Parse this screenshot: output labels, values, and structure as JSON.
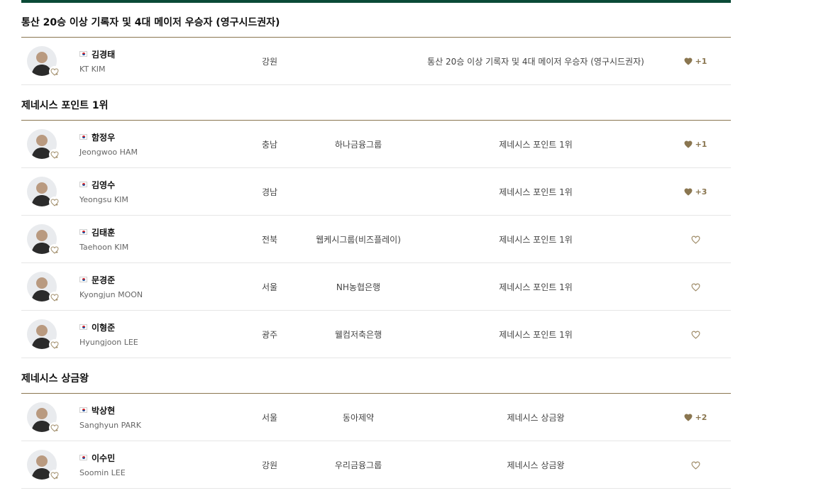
{
  "colors": {
    "brand_green": "#0b4a37",
    "accent_gold": "#8a7650"
  },
  "sections": [
    {
      "title": "통산 20승 이상 기록자 및 4대 메이저 우승자 (영구시드권자)",
      "players": [
        {
          "name_ko": "김경태",
          "name_en": "KT KIM",
          "region": "강원",
          "sponsor": "",
          "category": "통산 20승 이상 기록자 및 4대 메이저 우승자 (영구시드권자)",
          "likes": "+1",
          "liked": true
        }
      ]
    },
    {
      "title": "제네시스 포인트 1위",
      "players": [
        {
          "name_ko": "함정우",
          "name_en": "Jeongwoo HAM",
          "region": "충남",
          "sponsor": "하나금융그룹",
          "category": "제네시스 포인트 1위",
          "likes": "+1",
          "liked": true
        },
        {
          "name_ko": "김영수",
          "name_en": "Yeongsu KIM",
          "region": "경남",
          "sponsor": "",
          "category": "제네시스 포인트 1위",
          "likes": "+3",
          "liked": true
        },
        {
          "name_ko": "김태훈",
          "name_en": "Taehoon KIM",
          "region": "전북",
          "sponsor": "웹케시그룹(비즈플레이)",
          "category": "제네시스 포인트 1위",
          "likes": "",
          "liked": false
        },
        {
          "name_ko": "문경준",
          "name_en": "Kyongjun MOON",
          "region": "서울",
          "sponsor": "NH농협은행",
          "category": "제네시스 포인트 1위",
          "likes": "",
          "liked": false
        },
        {
          "name_ko": "이형준",
          "name_en": "Hyungjoon LEE",
          "region": "광주",
          "sponsor": "웰컴저축은행",
          "category": "제네시스 포인트 1위",
          "likes": "",
          "liked": false
        }
      ]
    },
    {
      "title": "제네시스 상금왕",
      "players": [
        {
          "name_ko": "박상현",
          "name_en": "Sanghyun PARK",
          "region": "서울",
          "sponsor": "동아제약",
          "category": "제네시스 상금왕",
          "likes": "+2",
          "liked": true
        },
        {
          "name_ko": "이수민",
          "name_en": "Soomin LEE",
          "region": "강원",
          "sponsor": "우리금융그룹",
          "category": "제네시스 상금왕",
          "likes": "",
          "liked": false
        }
      ]
    }
  ]
}
